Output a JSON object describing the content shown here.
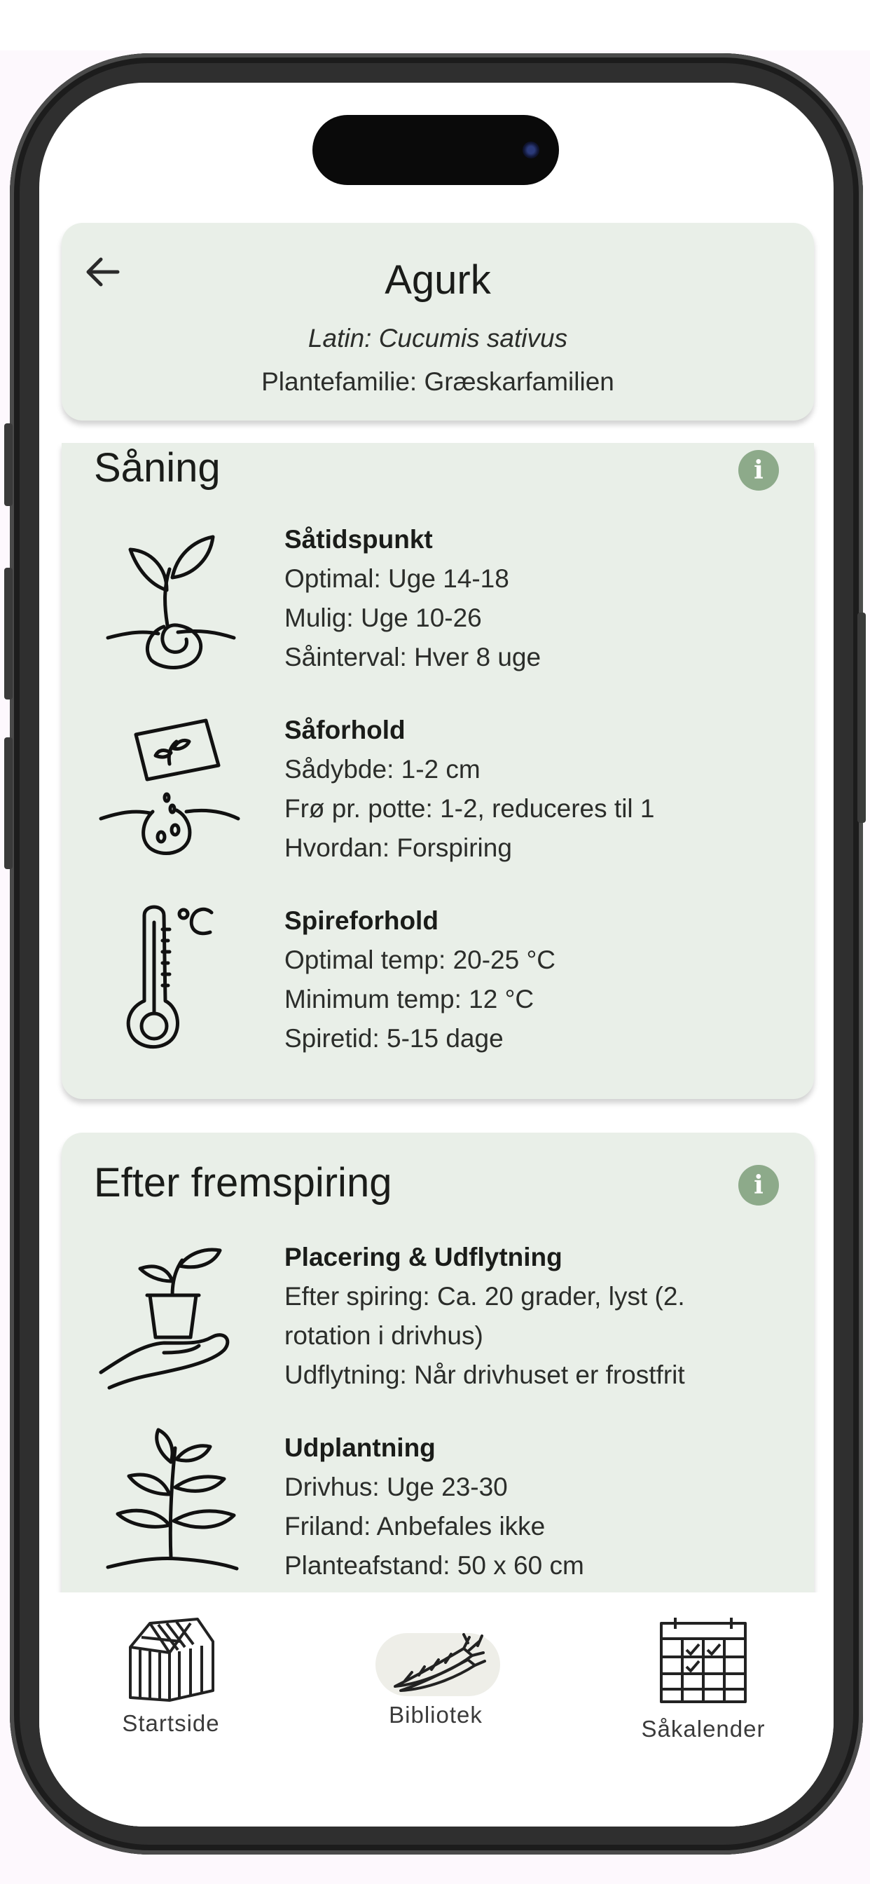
{
  "header": {
    "back_icon": "arrow-left-icon",
    "plant_name": "Agurk",
    "latin": "Latin: Cucumis sativus",
    "family": "Plantefamilie: Græskarfamilien"
  },
  "sections": [
    {
      "title": "Såning",
      "info_icon": "info-icon",
      "items": [
        {
          "icon": "seedling-icon",
          "title": "Såtidspunkt",
          "lines": [
            "Optimal: Uge 14-18",
            "Mulig: Uge 10-26",
            "Såinterval: Hver 8 uge"
          ]
        },
        {
          "icon": "seed-packet-icon",
          "title": "Såforhold",
          "lines": [
            "Sådybde: 1-2 cm",
            "Frø pr. potte: 1-2, reduceres til 1",
            "Hvordan: Forspiring"
          ]
        },
        {
          "icon": "thermometer-icon",
          "title": "Spireforhold",
          "lines": [
            "Optimal temp: 20-25 °C",
            "Minimum temp: 12 °C",
            "Spiretid: 5-15 dage"
          ]
        }
      ]
    },
    {
      "title": "Efter fremspiring",
      "info_icon": "info-icon",
      "items": [
        {
          "icon": "potted-plant-hand-icon",
          "title": "Placering & Udflytning",
          "lines": [
            "Efter spiring: Ca. 20 grader, lyst (2.",
            "rotation i drivhus)",
            "Udflytning: Når drivhuset er frostfrit"
          ]
        },
        {
          "icon": "plant-icon",
          "title": "Udplantning",
          "lines": [
            "Drivhus: Uge 23-30",
            "Friland: Anbefales ikke",
            "Planteafstand: 50 x 60 cm"
          ]
        }
      ]
    }
  ],
  "bottom_nav": [
    {
      "label": "Startside",
      "icon": "greenhouse-icon",
      "active": false
    },
    {
      "label": "Bibliotek",
      "icon": "carrots-icon",
      "active": true
    },
    {
      "label": "Såkalender",
      "icon": "calendar-icon",
      "active": false
    }
  ],
  "colors": {
    "card_bg": "#e9efe8",
    "info_icon": "#8daa8a",
    "nav_active_pill": "#eeeee8"
  }
}
